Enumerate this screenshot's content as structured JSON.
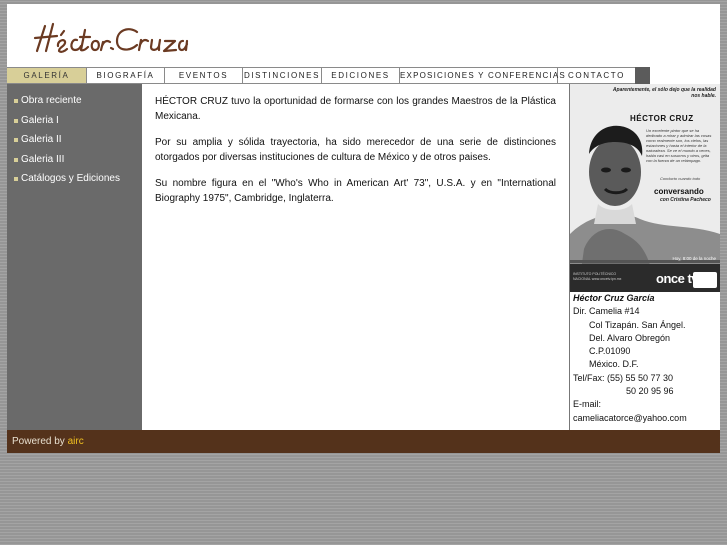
{
  "header": {
    "logo_text": "Héctor Cruz"
  },
  "nav": [
    {
      "label": "GALERÍA",
      "active": true
    },
    {
      "label": "BIOGRAFÍA"
    },
    {
      "label": "EVENTOS"
    },
    {
      "label": "DISTINCIONES"
    },
    {
      "label": "EDICIONES"
    },
    {
      "label": "EXPOSICIONES Y CONFERENCIAS"
    },
    {
      "label": "CONTACTO"
    }
  ],
  "sidebar": {
    "items": [
      "Obra reciente",
      "Galeria I",
      "Galeria II",
      "Galeria III",
      "Catálogos y Ediciones"
    ]
  },
  "main": {
    "paragraphs": [
      "HÉCTOR CRUZ tuvo la oportunidad de formarse con los grandes Maestros de la Plástica Mexicana.",
      "Por su amplia y sólida trayectoria, ha sido merecedor de una serie de distinciones otorgados por diversas instituciones de cultura de México y de otros paises.",
      "Su nombre figura en el \"Who's Who in American Art' 73\", U.S.A. y en \"International Biography 1975\", Cambridge, Inglaterra."
    ]
  },
  "poster": {
    "top_caption": "Aparentemente, el sólo dejo que la realidad nos hable.",
    "name": "HÉCTOR CRUZ",
    "desc": "Un excelente pintor que se ha dedicado a mirar y admirar las cosas como realmente son, los cielos, las estaciones y hasta el interior de la naturaleza. Se ve el mundo a veces, habla casi en susurros y otros, grita con la fuerza de un relámpago.",
    "quote": "Conducto cuando todo",
    "show": "conversando",
    "host": "con Cristina Pacheco",
    "schedule": "Hoy, 8:00 de la noche",
    "channel": "once tv",
    "institute": "INSTITUTO POLITÉCNICO NACIONAL www.oncetv.ipn.mx"
  },
  "contact": {
    "name": "Héctor Cruz García",
    "lines": [
      "Dir. Camelia #14",
      "Col Tizapán. San Ángel.",
      "Del. Alvaro Obregón",
      "C.P.01090",
      "México. D.F.",
      "Tel/Fax: (55) 55 50 77 30",
      "50 20 95 96",
      "E-mail:",
      "cameliacatorce@yahoo.com"
    ]
  },
  "footer": {
    "powered": "Powered by",
    "link": "airc"
  }
}
